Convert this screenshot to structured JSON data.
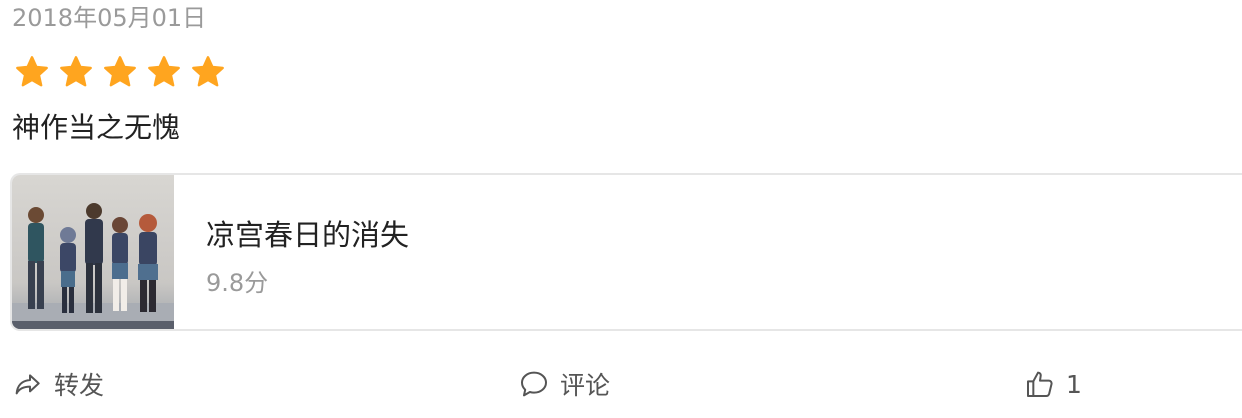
{
  "post": {
    "date": "2018年05月01日",
    "rating": 5,
    "review": "神作当之无愧"
  },
  "movie": {
    "title": "凉宫春日的消失",
    "score": "9.8分"
  },
  "actions": {
    "share_label": "转发",
    "comment_label": "评论",
    "like_count": "1"
  },
  "colors": {
    "star": "#FFA51F",
    "text_secondary": "#9A9A9A",
    "text_primary": "#222222",
    "icon": "#555555"
  },
  "icons": [
    "star-icon",
    "share-icon",
    "comment-icon",
    "thumbs-up-icon"
  ]
}
